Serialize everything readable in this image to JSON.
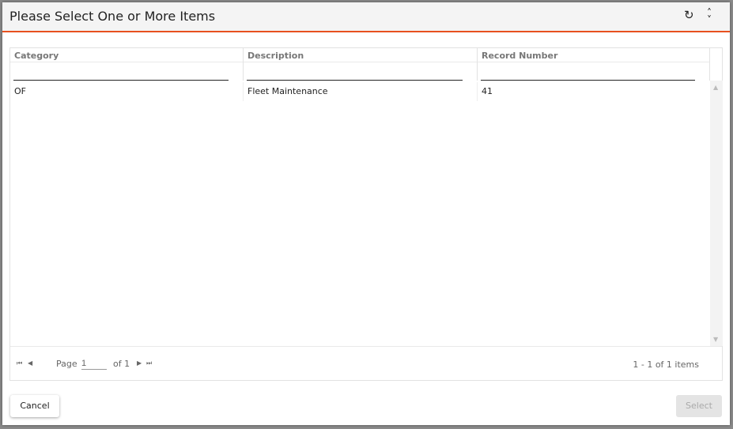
{
  "dialog": {
    "title": "Please Select One or More Items",
    "icons": [
      "refresh-icon",
      "expand-collapse-icon"
    ],
    "accent": "#e8501f"
  },
  "grid": {
    "columns": [
      {
        "label": "Category"
      },
      {
        "label": "Description"
      },
      {
        "label": "Record Number"
      }
    ],
    "filters": [
      "",
      "",
      ""
    ],
    "rows": [
      [
        "OF",
        "Fleet Maintenance",
        "41"
      ]
    ]
  },
  "pager": {
    "page_label": "Page",
    "page_value": "1",
    "of_label": "of 1",
    "summary": "1 - 1 of 1 items"
  },
  "footer": {
    "cancel": "Cancel",
    "select": "Select"
  }
}
